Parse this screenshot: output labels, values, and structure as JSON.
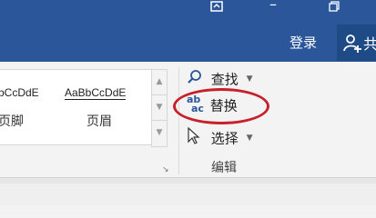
{
  "window": {
    "restore_icon": "restore-window-icon",
    "minimize_icon": "minimize-icon",
    "maximize_icon": "maximize-icon"
  },
  "account": {
    "login_label": "登录",
    "share_label": "共",
    "share_icon": "add-person-icon"
  },
  "styles": {
    "items": [
      {
        "sample": "bCcDdE",
        "name": "页脚"
      },
      {
        "sample": "AaBbCcDdE",
        "name": "页眉"
      }
    ]
  },
  "editing": {
    "group_label": "编辑",
    "find_label": "查找",
    "replace_label": "替换",
    "select_label": "选择"
  },
  "colors": {
    "title_bar": "#2b579a",
    "highlight_ring": "#c8202a"
  }
}
